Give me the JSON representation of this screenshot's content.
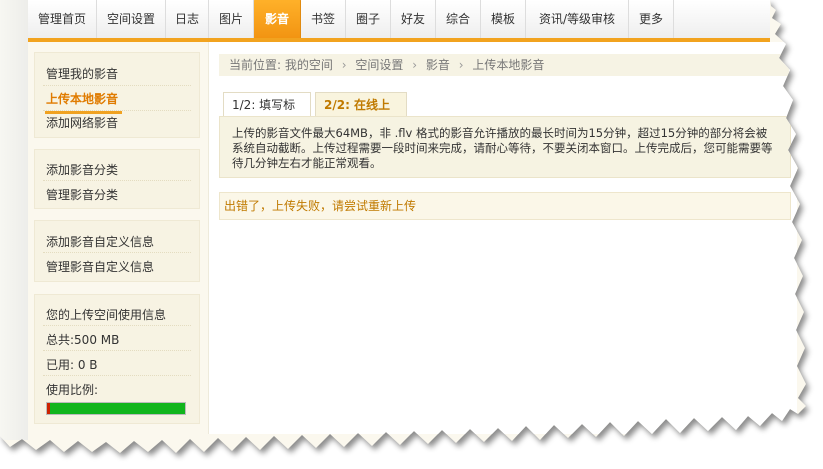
{
  "nav": {
    "items": [
      {
        "label": "管理首页"
      },
      {
        "label": "空间设置"
      },
      {
        "label": "日志"
      },
      {
        "label": "图片"
      },
      {
        "label": "影音",
        "active": true
      },
      {
        "label": "书签"
      },
      {
        "label": "圈子"
      },
      {
        "label": "好友"
      },
      {
        "label": "综合"
      },
      {
        "label": "模板"
      },
      {
        "label": "资讯/等级审核"
      },
      {
        "label": "更多"
      }
    ]
  },
  "sidebar": {
    "group1": {
      "manage": "管理我的影音",
      "upload_local": "上传本地影音",
      "add_web": "添加网络影音"
    },
    "group2": {
      "add_category": "添加影音分类",
      "manage_category": "管理影音分类"
    },
    "group3": {
      "add_custom": "添加影音自定义信息",
      "manage_custom": "管理影音自定义信息"
    },
    "usage": {
      "title": "您的上传空间使用信息",
      "total": "总共:500 MB",
      "used": "已用: 0 B",
      "ratio_label": "使用比例:",
      "ratio": 0
    }
  },
  "breadcrumb": {
    "prefix": "当前位置:",
    "items": [
      "我的空间",
      "空间设置",
      "影音",
      "上传本地影音"
    ]
  },
  "tabs": {
    "step1": "1/2: 填写标题",
    "step2": "2/2: 在线上传"
  },
  "description": "上传的影音文件最大64MB，非 .flv 格式的影音允许播放的最长时间为15分钟，超过15分钟的部分将会被系统自动截断。上传过程需要一段时间来完成，请耐心等待，不要关闭本窗口。上传完成后，您可能需要等待几分钟左右才能正常观看。",
  "error_message": "出错了，上传失败，请尝试重新上传",
  "colors": {
    "accent": "#f2a31f",
    "active_link": "#e07b00",
    "usage_fill": "#11b51c"
  }
}
